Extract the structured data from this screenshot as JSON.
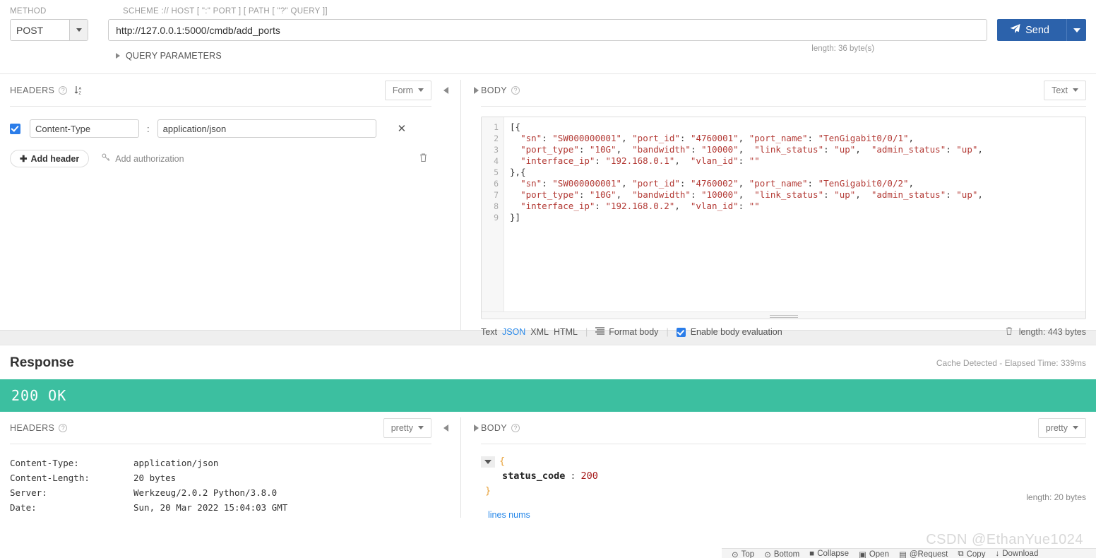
{
  "request": {
    "label_method": "METHOD",
    "label_scheme": "SCHEME :// HOST [ \":\" PORT ] [ PATH [ \"?\" QUERY ]]",
    "method": "POST",
    "url": "http://127.0.0.1:5000/cmdb/add_ports",
    "url_length": "length: 36 byte(s)",
    "send_label": "Send",
    "query_parameters": "QUERY PARAMETERS"
  },
  "headers_panel": {
    "title": "HEADERS",
    "view_mode": "Form",
    "rows": [
      {
        "enabled": true,
        "key": "Content-Type",
        "value": "application/json"
      }
    ],
    "add_header": "Add header",
    "add_authorization": "Add authorization"
  },
  "body_panel": {
    "title": "BODY",
    "view_mode": "Text",
    "lines": [
      {
        "n": "1",
        "segments": [
          {
            "t": "[{",
            "c": "plain"
          }
        ]
      },
      {
        "n": "2",
        "segments": [
          {
            "t": "  ",
            "c": "plain"
          },
          {
            "t": "\"sn\"",
            "c": "str"
          },
          {
            "t": ": ",
            "c": "plain"
          },
          {
            "t": "\"SW000000001\"",
            "c": "str"
          },
          {
            "t": ", ",
            "c": "plain"
          },
          {
            "t": "\"port_id\"",
            "c": "str"
          },
          {
            "t": ": ",
            "c": "plain"
          },
          {
            "t": "\"4760001\"",
            "c": "str"
          },
          {
            "t": ", ",
            "c": "plain"
          },
          {
            "t": "\"port_name\"",
            "c": "str"
          },
          {
            "t": ": ",
            "c": "plain"
          },
          {
            "t": "\"TenGigabit0/0/1\"",
            "c": "str"
          },
          {
            "t": ",",
            "c": "plain"
          }
        ]
      },
      {
        "n": "3",
        "segments": [
          {
            "t": "  ",
            "c": "plain"
          },
          {
            "t": "\"port_type\"",
            "c": "str"
          },
          {
            "t": ": ",
            "c": "plain"
          },
          {
            "t": "\"10G\"",
            "c": "str"
          },
          {
            "t": ",  ",
            "c": "plain"
          },
          {
            "t": "\"bandwidth\"",
            "c": "str"
          },
          {
            "t": ": ",
            "c": "plain"
          },
          {
            "t": "\"10000\"",
            "c": "str"
          },
          {
            "t": ",  ",
            "c": "plain"
          },
          {
            "t": "\"link_status\"",
            "c": "str"
          },
          {
            "t": ": ",
            "c": "plain"
          },
          {
            "t": "\"up\"",
            "c": "str"
          },
          {
            "t": ",  ",
            "c": "plain"
          },
          {
            "t": "\"admin_status\"",
            "c": "str"
          },
          {
            "t": ": ",
            "c": "plain"
          },
          {
            "t": "\"up\"",
            "c": "str"
          },
          {
            "t": ",",
            "c": "plain"
          }
        ]
      },
      {
        "n": "4",
        "segments": [
          {
            "t": "  ",
            "c": "plain"
          },
          {
            "t": "\"interface_ip\"",
            "c": "str"
          },
          {
            "t": ": ",
            "c": "plain"
          },
          {
            "t": "\"192.168.0.1\"",
            "c": "str"
          },
          {
            "t": ",  ",
            "c": "plain"
          },
          {
            "t": "\"vlan_id\"",
            "c": "str"
          },
          {
            "t": ": ",
            "c": "plain"
          },
          {
            "t": "\"\"",
            "c": "str"
          }
        ]
      },
      {
        "n": "5",
        "segments": [
          {
            "t": "},{",
            "c": "plain"
          }
        ]
      },
      {
        "n": "6",
        "segments": [
          {
            "t": "  ",
            "c": "plain"
          },
          {
            "t": "\"sn\"",
            "c": "str"
          },
          {
            "t": ": ",
            "c": "plain"
          },
          {
            "t": "\"SW000000001\"",
            "c": "str"
          },
          {
            "t": ", ",
            "c": "plain"
          },
          {
            "t": "\"port_id\"",
            "c": "str"
          },
          {
            "t": ": ",
            "c": "plain"
          },
          {
            "t": "\"4760002\"",
            "c": "str"
          },
          {
            "t": ", ",
            "c": "plain"
          },
          {
            "t": "\"port_name\"",
            "c": "str"
          },
          {
            "t": ": ",
            "c": "plain"
          },
          {
            "t": "\"TenGigabit0/0/2\"",
            "c": "str"
          },
          {
            "t": ",",
            "c": "plain"
          }
        ]
      },
      {
        "n": "7",
        "segments": [
          {
            "t": "  ",
            "c": "plain"
          },
          {
            "t": "\"port_type\"",
            "c": "str"
          },
          {
            "t": ": ",
            "c": "plain"
          },
          {
            "t": "\"10G\"",
            "c": "str"
          },
          {
            "t": ",  ",
            "c": "plain"
          },
          {
            "t": "\"bandwidth\"",
            "c": "str"
          },
          {
            "t": ": ",
            "c": "plain"
          },
          {
            "t": "\"10000\"",
            "c": "str"
          },
          {
            "t": ",  ",
            "c": "plain"
          },
          {
            "t": "\"link_status\"",
            "c": "str"
          },
          {
            "t": ": ",
            "c": "plain"
          },
          {
            "t": "\"up\"",
            "c": "str"
          },
          {
            "t": ",  ",
            "c": "plain"
          },
          {
            "t": "\"admin_status\"",
            "c": "str"
          },
          {
            "t": ": ",
            "c": "plain"
          },
          {
            "t": "\"up\"",
            "c": "str"
          },
          {
            "t": ",",
            "c": "plain"
          }
        ]
      },
      {
        "n": "8",
        "segments": [
          {
            "t": "  ",
            "c": "plain"
          },
          {
            "t": "\"interface_ip\"",
            "c": "str"
          },
          {
            "t": ": ",
            "c": "plain"
          },
          {
            "t": "\"192.168.0.2\"",
            "c": "str"
          },
          {
            "t": ",  ",
            "c": "plain"
          },
          {
            "t": "\"vlan_id\"",
            "c": "str"
          },
          {
            "t": ": ",
            "c": "plain"
          },
          {
            "t": "\"\"",
            "c": "str"
          }
        ]
      },
      {
        "n": "9",
        "segments": [
          {
            "t": "}]",
            "c": "plain"
          }
        ]
      }
    ],
    "footer": {
      "formats": [
        {
          "label": "Text",
          "active": false
        },
        {
          "label": "JSON",
          "active": true
        },
        {
          "label": "XML",
          "active": false
        },
        {
          "label": "HTML",
          "active": false
        }
      ],
      "format_body": "Format body",
      "enable_body_evaluation": "Enable body evaluation",
      "enable_body_evaluation_checked": true,
      "length": "length: 443 bytes"
    }
  },
  "response": {
    "title": "Response",
    "meta": "Cache Detected - Elapsed Time: 339ms",
    "status": "200 OK",
    "status_color": "#3cbfa0",
    "headers_panel": {
      "title": "HEADERS",
      "view_mode": "pretty",
      "rows": [
        {
          "key": "Content-Type:",
          "value": "application/json"
        },
        {
          "key": "Content-Length:",
          "value": "20 bytes"
        },
        {
          "key": "Server:",
          "value": "Werkzeug/2.0.2 Python/3.8.0"
        },
        {
          "key": "Date:",
          "value": "Sun, 20 Mar 2022 15:04:03 GMT"
        }
      ]
    },
    "body_panel": {
      "title": "BODY",
      "view_mode": "pretty",
      "open_brace": "{",
      "close_brace": "}",
      "key": "status_code",
      "colon": ":",
      "value": "200",
      "lines_nums": "lines nums",
      "length": "length: 20 bytes"
    },
    "toolbar": [
      {
        "label": "Top",
        "icon": "arrow-up-circle-icon"
      },
      {
        "label": "Bottom",
        "icon": "arrow-down-circle-icon"
      },
      {
        "label": "Collapse",
        "icon": "collapse-icon"
      },
      {
        "label": "Open",
        "icon": "open-icon"
      },
      {
        "label": "@Request",
        "icon": "request-icon"
      },
      {
        "label": "Copy",
        "icon": "copy-icon"
      },
      {
        "label": "Download",
        "icon": "download-icon"
      }
    ]
  },
  "watermark": "CSDN @EthanYue1024",
  "icons": {
    "send": "paper-plane-icon",
    "caret_down": "chevron-down-icon",
    "sort": "sort-alpha-icon",
    "help": "question-mark-icon",
    "remove": "close-icon",
    "trash": "trash-icon",
    "key": "key-icon",
    "plus": "plus-icon"
  }
}
